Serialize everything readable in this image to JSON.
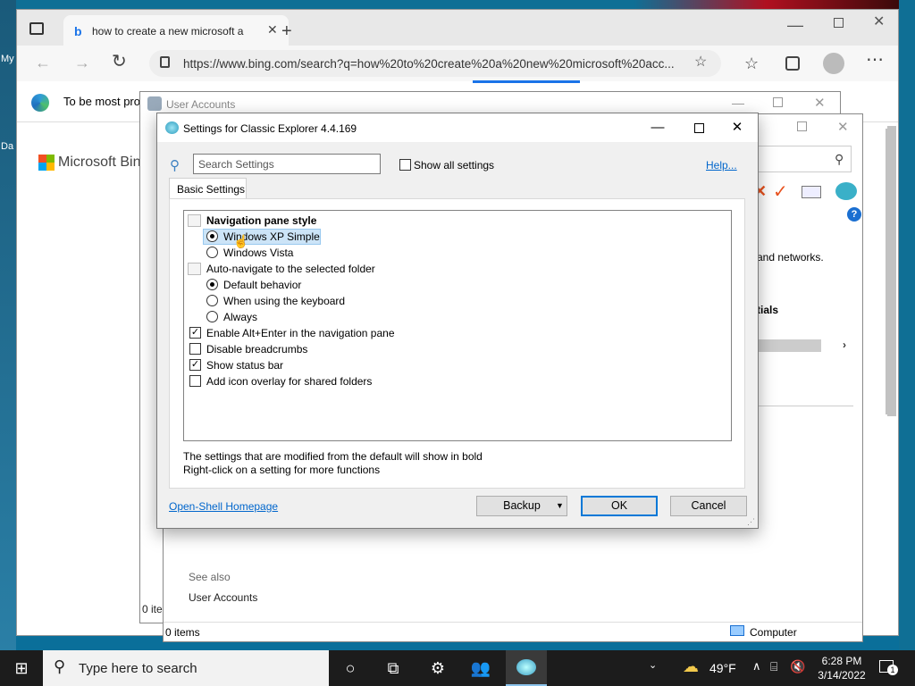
{
  "desktop": {
    "labels": [
      "My",
      "Da"
    ]
  },
  "browser": {
    "tab_title": "how to create a new microsoft a",
    "url": "https://www.bing.com/search?q=how%20to%20create%20a%20new%20microsoft%20acc...",
    "infobar_text": "To be most pro",
    "bing_logo": "Microsoft Bing"
  },
  "user_accounts": {
    "title": "User Accounts",
    "networks_text": "and networks.",
    "credentials_text": "tials",
    "see_also": "See also",
    "see_also_link": "User Accounts",
    "status_items": "0 items",
    "status_items_back": "0 ite",
    "status_computer": "Computer"
  },
  "dialog": {
    "title": "Settings for Classic Explorer 4.4.169",
    "search_placeholder": "Search Settings",
    "show_all": "Show all settings",
    "help": "Help...",
    "tab": "Basic Settings",
    "settings": [
      {
        "label": "Navigation pane style",
        "kind": "header",
        "bold": true
      },
      {
        "label": "Windows XP Simple",
        "kind": "radio",
        "checked": true,
        "selected": true
      },
      {
        "label": "Windows Vista",
        "kind": "radio",
        "checked": false
      },
      {
        "label": "Auto-navigate to the selected folder",
        "kind": "header"
      },
      {
        "label": "Default behavior",
        "kind": "radio",
        "checked": true
      },
      {
        "label": "When using the keyboard",
        "kind": "radio",
        "checked": false
      },
      {
        "label": "Always",
        "kind": "radio",
        "checked": false
      },
      {
        "label": "Enable Alt+Enter in the navigation pane",
        "kind": "check",
        "checked": true
      },
      {
        "label": "Disable breadcrumbs",
        "kind": "check",
        "checked": false
      },
      {
        "label": "Show status bar",
        "kind": "check",
        "checked": true
      },
      {
        "label": "Add icon overlay for shared folders",
        "kind": "check",
        "checked": false
      }
    ],
    "note1": "The settings that are modified from the default will show in bold",
    "note2": "Right-click on a setting for more functions",
    "homepage": "Open-Shell Homepage",
    "backup": "Backup",
    "ok": "OK",
    "cancel": "Cancel"
  },
  "taskbar": {
    "search_placeholder": "Type here to search",
    "weather": "49°F",
    "time": "6:28 PM",
    "date": "3/14/2022",
    "notifications": "1"
  }
}
